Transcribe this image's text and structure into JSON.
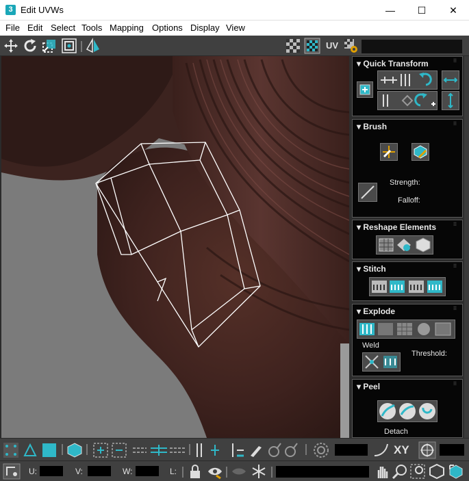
{
  "window": {
    "title": "Edit UVWs",
    "app_icon_text": "3",
    "minimize": "—",
    "maximize": "☐",
    "close": "✕"
  },
  "menu": {
    "items": [
      "File",
      "Edit",
      "Select",
      "Tools",
      "Mapping",
      "Options",
      "Display",
      "View"
    ]
  },
  "toolbar": {
    "uv_label": "UV",
    "icons": [
      "move-icon",
      "rotate-icon",
      "scale-icon",
      "freeform-icon",
      "mirror-icon",
      "checker-icon",
      "checker-pattern-icon",
      "settings-icon"
    ]
  },
  "panel": {
    "quick_transform": {
      "title": "Quick Transform"
    },
    "brush": {
      "title": "Brush",
      "strength_label": "Strength:",
      "falloff_label": "Falloff:"
    },
    "reshape": {
      "title": "Reshape Elements"
    },
    "stitch": {
      "title": "Stitch"
    },
    "explode": {
      "title": "Explode",
      "weld_label": "Weld",
      "threshold_label": "Threshold:"
    },
    "peel": {
      "title": "Peel",
      "detach_label": "Detach"
    }
  },
  "bottom": {
    "xy_label": "XY",
    "u_label": "U:",
    "v_label": "V:",
    "w_label": "W:",
    "l_label": "L:"
  },
  "colors": {
    "accent": "#2fb8c8",
    "panel_bg": "#060606",
    "toolbar_bg": "#404040"
  }
}
